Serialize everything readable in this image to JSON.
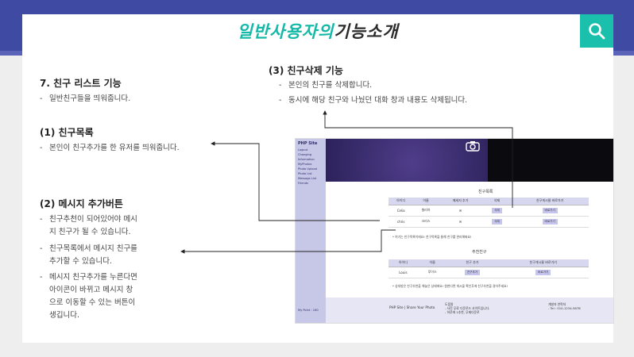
{
  "header": {
    "title_accent": "일반사용자의",
    "title_rest": "기능소개"
  },
  "accent_color": "#1bc0ac",
  "search_icon": "search-icon",
  "section7": {
    "title": "7. 친구 리스트 기능",
    "desc": "일반친구들을 띄워줍니다."
  },
  "item1": {
    "title": "(1) 친구목록",
    "desc": "본인이 친구추가를 한 유저를 띄워줍니다."
  },
  "item2": {
    "title": "(2) 메시지 추가버튼",
    "bullets": [
      "친구추천이 되어있어야 메시\n지 친구가 될 수 있습니다.",
      "친구목록에서 메시지 친구를\n추가할 수 있습니다.",
      "메시지 친구추가를 누른다면\n아이콘이 바뀌고 메시지 창\n으로 이동할 수 있는 버튼이\n생깁니다."
    ]
  },
  "item3": {
    "title": "(3) 친구삭제 기능",
    "bullets": [
      "본인의 친구를 삭제합니다.",
      "동시에 해당 친구와 나눴던 대화 창과 내용도 삭제됩니다."
    ]
  },
  "dash": "-",
  "screenshot": {
    "site": "PHP Site",
    "menu": [
      "Logout",
      "Changing",
      "Information",
      "MyPhotos",
      "Photo Upload",
      "Photo List",
      "Message List",
      "Friends"
    ],
    "point": "My Point : 160",
    "friends_title": "친구목록",
    "friends_headers": [
      "아이디",
      "이름",
      "메세지 추가",
      "삭제",
      "친구게시물 바로가기"
    ],
    "friends_rows": [
      [
        "Celia",
        "셀리아",
        "✉",
        "삭제",
        "바로가기"
      ],
      [
        "chris",
        "크리스",
        "✉",
        "삭제",
        "바로가기"
      ]
    ],
    "friends_note": "* 여기는 친구목록이에요! 친구목록을 통해 친구를 관리해봐요!",
    "recommend_title": "추천친구",
    "recommend_headers": [
      "아이디",
      "이름",
      "친구 추가",
      "친구게시물 바로가기"
    ],
    "recommend_rows": [
      [
        "Louis",
        "루이스",
        "친구추가",
        "바로가기"
      ]
    ],
    "recommend_note": "* 상대방은 친구추천을 해놓은 상태에요! 원한다면 게시물 확인후에 친구추천을 걸어주세요!",
    "footer_main": "PHP Site | Share Your Photo",
    "footer_left": "도움말\n- 사진 무료 다운로드 사이트입니다.\n- 하루에 1추천, 무제다운로",
    "footer_right": "개발자 연락처\n- Tel : 010-1234-5678"
  }
}
